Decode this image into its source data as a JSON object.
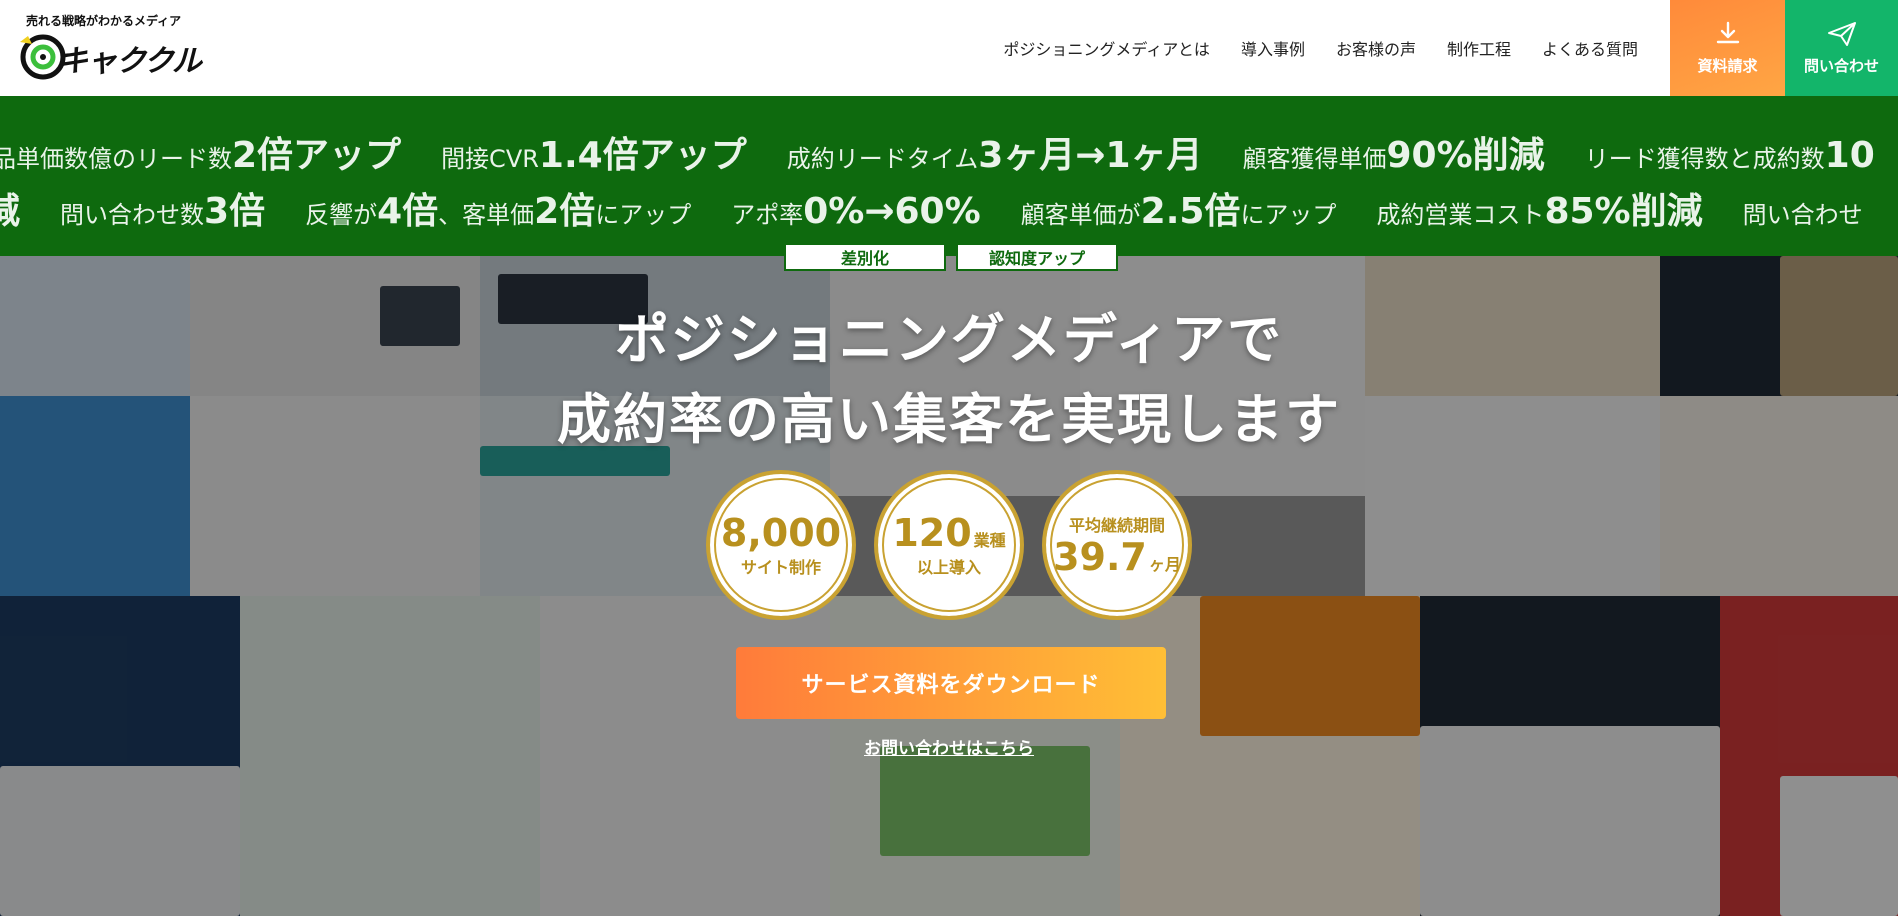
{
  "header": {
    "logo_tagline": "売れる戦略がわかるメディア",
    "logo_name": "キャククル",
    "nav": [
      "ポジショニングメディアとは",
      "導入事例",
      "お客様の声",
      "制作工程",
      "よくある質問"
    ],
    "cta_document": "資料請求",
    "cta_contact": "問い合わせ",
    "icons": {
      "document": "download-icon",
      "contact": "paper-plane-icon"
    }
  },
  "ticker": {
    "row1": [
      {
        "pre": "品単価数億のリード数",
        "em": "2倍アップ",
        "post": ""
      },
      {
        "pre": "間接CVR",
        "em": "1.4倍アップ",
        "post": ""
      },
      {
        "pre": "成約リードタイム",
        "em": "3ヶ月→1ヶ月",
        "post": ""
      },
      {
        "pre": "顧客獲得単価",
        "em": "90%削減",
        "post": ""
      },
      {
        "pre": "リード獲得数と成約数",
        "em": "10",
        "post": ""
      }
    ],
    "row2": [
      {
        "pre": "",
        "em": "減",
        "post": ""
      },
      {
        "pre": "問い合わせ数",
        "em": "3倍",
        "post": ""
      },
      {
        "pre": "反響が",
        "em": "4倍",
        "post": "、客単価"
      },
      {
        "pre": "",
        "em": "2倍",
        "post": "にアップ"
      },
      {
        "pre": "アポ率",
        "em": "0%→60%",
        "post": ""
      },
      {
        "pre": "顧客単価が",
        "em": "2.5倍",
        "post": "にアップ"
      },
      {
        "pre": "成約営業コスト",
        "em": "85%削減",
        "post": ""
      },
      {
        "pre": "問い合わせ",
        "em": "",
        "post": ""
      }
    ]
  },
  "hero": {
    "tags": [
      "差別化",
      "認知度アップ"
    ],
    "headline_line1": "ポジショニングメディアで",
    "headline_line2": "成約率の高い集客を実現します",
    "badges": {
      "sites_value": "8,000",
      "sites_label": "サイト制作",
      "industries_value": "120",
      "industries_unit": "業種",
      "industries_label": "以上導入",
      "duration_label": "平均継続期間",
      "duration_value": "39.7",
      "duration_unit": "ヶ月"
    },
    "download_button": "サービス資料をダウンロード",
    "contact_link": "お問い合わせはこちら"
  },
  "colors": {
    "brand_green": "#0e6a0e",
    "cta_orange": "#ff8a3a",
    "cta_green": "#13b56a",
    "badge_gold": "#c9a232"
  }
}
